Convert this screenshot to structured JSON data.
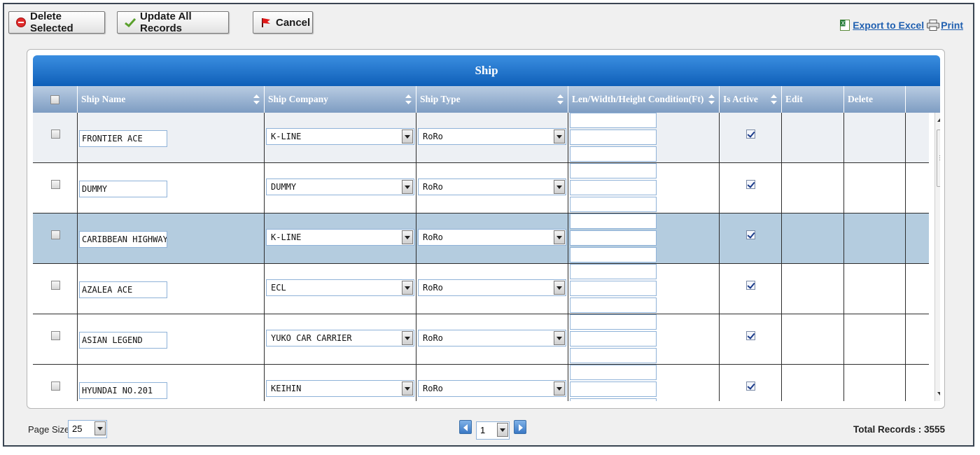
{
  "toolbar": {
    "delete_label": "Delete Selected",
    "update_label": "Update All Records",
    "cancel_label": "Cancel",
    "export_label": "Export to Excel",
    "print_label": "Print"
  },
  "grid": {
    "title": "Ship",
    "columns": [
      {
        "label": ""
      },
      {
        "label": "Ship Name",
        "sortable": true
      },
      {
        "label": "Ship Company",
        "sortable": true
      },
      {
        "label": "Ship Type",
        "sortable": true
      },
      {
        "label": "Len/Width/Height Condition(Ft)",
        "sortable": true
      },
      {
        "label": "Is Active",
        "sortable": true
      },
      {
        "label": "Edit",
        "sortable": false
      },
      {
        "label": "Delete",
        "sortable": false
      }
    ],
    "rows": [
      {
        "ship_name": "FRONTIER ACE",
        "company": "K-LINE",
        "type": "RoRo",
        "active": true,
        "selected": false,
        "alt": true
      },
      {
        "ship_name": "DUMMY",
        "company": "DUMMY",
        "type": "RoRo",
        "active": true,
        "selected": false,
        "alt": false
      },
      {
        "ship_name": "CARIBBEAN HIGHWAY",
        "company": "K-LINE",
        "type": "RoRo",
        "active": true,
        "selected": true,
        "alt": false
      },
      {
        "ship_name": "AZALEA ACE",
        "company": "ECL",
        "type": "RoRo",
        "active": true,
        "selected": false,
        "alt": false
      },
      {
        "ship_name": "ASIAN LEGEND",
        "company": "YUKO CAR CARRIER",
        "type": "RoRo",
        "active": true,
        "selected": false,
        "alt": false
      },
      {
        "ship_name": "HYUNDAI NO.201",
        "company": "KEIHIN",
        "type": "RoRo",
        "active": true,
        "selected": false,
        "alt": false
      }
    ]
  },
  "footer": {
    "page_size_label": "Page Size",
    "page_size": "25",
    "page": "1",
    "total_label": "Total Records : 3555"
  },
  "colors": {
    "header_blue": "#0f5fb8",
    "column_header": "#7d9cc2",
    "selected_row": "#b4ccdf",
    "link": "#1f5fb0"
  }
}
